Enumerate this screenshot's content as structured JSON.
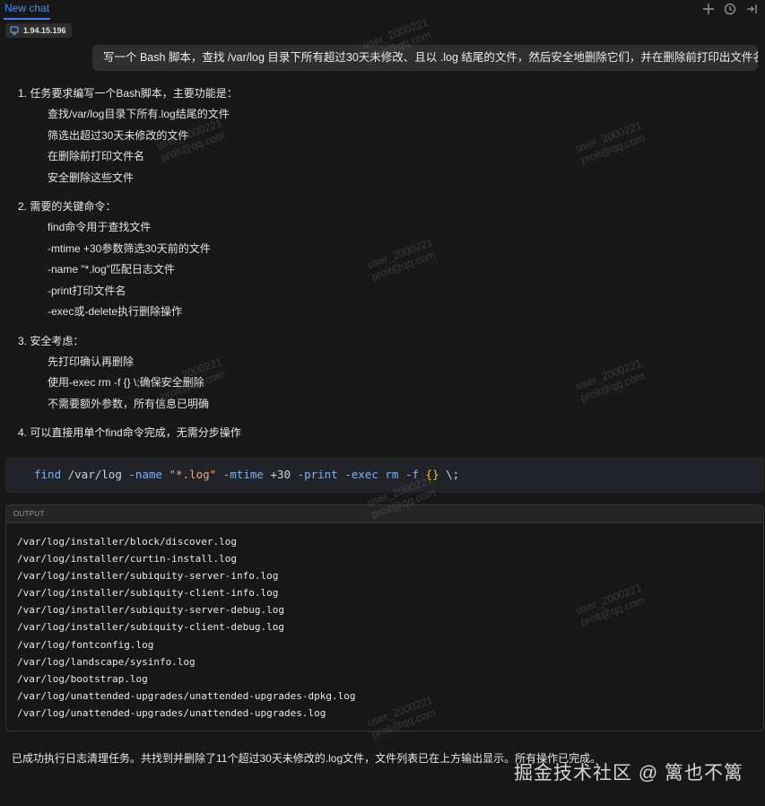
{
  "tabs": {
    "active_label": "New chat"
  },
  "top_icons": [
    "plus-icon",
    "history-icon",
    "collapse-icon"
  ],
  "chip": {
    "icon": "monitor-icon",
    "ip": "1.94.15.196"
  },
  "user_message": "写一个 Bash 脚本，查找 /var/log 目录下所有超过30天未修改、且以 .log 结尾的文件，然后安全地删除它们，并在删除前打印出文件名。",
  "answer": {
    "items": [
      {
        "head": "1. 任务要求编写一个Bash脚本，主要功能是：",
        "subs": [
          "查找/var/log目录下所有.log结尾的文件",
          "筛选出超过30天未修改的文件",
          "在删除前打印文件名",
          "安全删除这些文件"
        ]
      },
      {
        "head": "2. 需要的关键命令：",
        "subs": [
          "find命令用于查找文件",
          "-mtime +30参数筛选30天前的文件",
          "-name \"*.log\"匹配日志文件",
          "-print打印文件名",
          "-exec或-delete执行删除操作"
        ]
      },
      {
        "head": "3. 安全考虑：",
        "subs": [
          "先打印确认再删除",
          "使用-exec rm -f {} \\;确保安全删除",
          "不需要额外参数，所有信息已明确"
        ]
      },
      {
        "head": "4. 可以直接用单个find命令完成，无需分步操作",
        "subs": []
      }
    ]
  },
  "code": {
    "tokens": {
      "t1": "find",
      "t2": " /var/log ",
      "t3": "-name ",
      "t4": "\"*.log\"",
      "t5": " -mtime ",
      "t6": "+30",
      "t7": " -print ",
      "t8": "-exec ",
      "t9": "rm ",
      "t10": "-f ",
      "t11": "{}",
      "t12": " \\;"
    }
  },
  "output": {
    "label": "OUTPUT",
    "lines": [
      "/var/log/installer/block/discover.log",
      "/var/log/installer/curtin-install.log",
      "/var/log/installer/subiquity-server-info.log",
      "/var/log/installer/subiquity-client-info.log",
      "/var/log/installer/subiquity-server-debug.log",
      "/var/log/installer/subiquity-client-debug.log",
      "/var/log/fontconfig.log",
      "/var/log/landscape/sysinfo.log",
      "/var/log/bootstrap.log",
      "/var/log/unattended-upgrades/unattended-upgrades-dpkg.log",
      "/var/log/unattended-upgrades/unattended-upgrades.log"
    ]
  },
  "summary": "已成功执行日志清理任务。共找到并删除了11个超过30天未修改的.log文件，文件列表已在上方输出显示。所有操作已完成。",
  "watermark": {
    "line1": "user_2000221",
    "line2": "proit@qq.com"
  },
  "brand_mark": "掘金技术社区 @ 篱也不篱"
}
